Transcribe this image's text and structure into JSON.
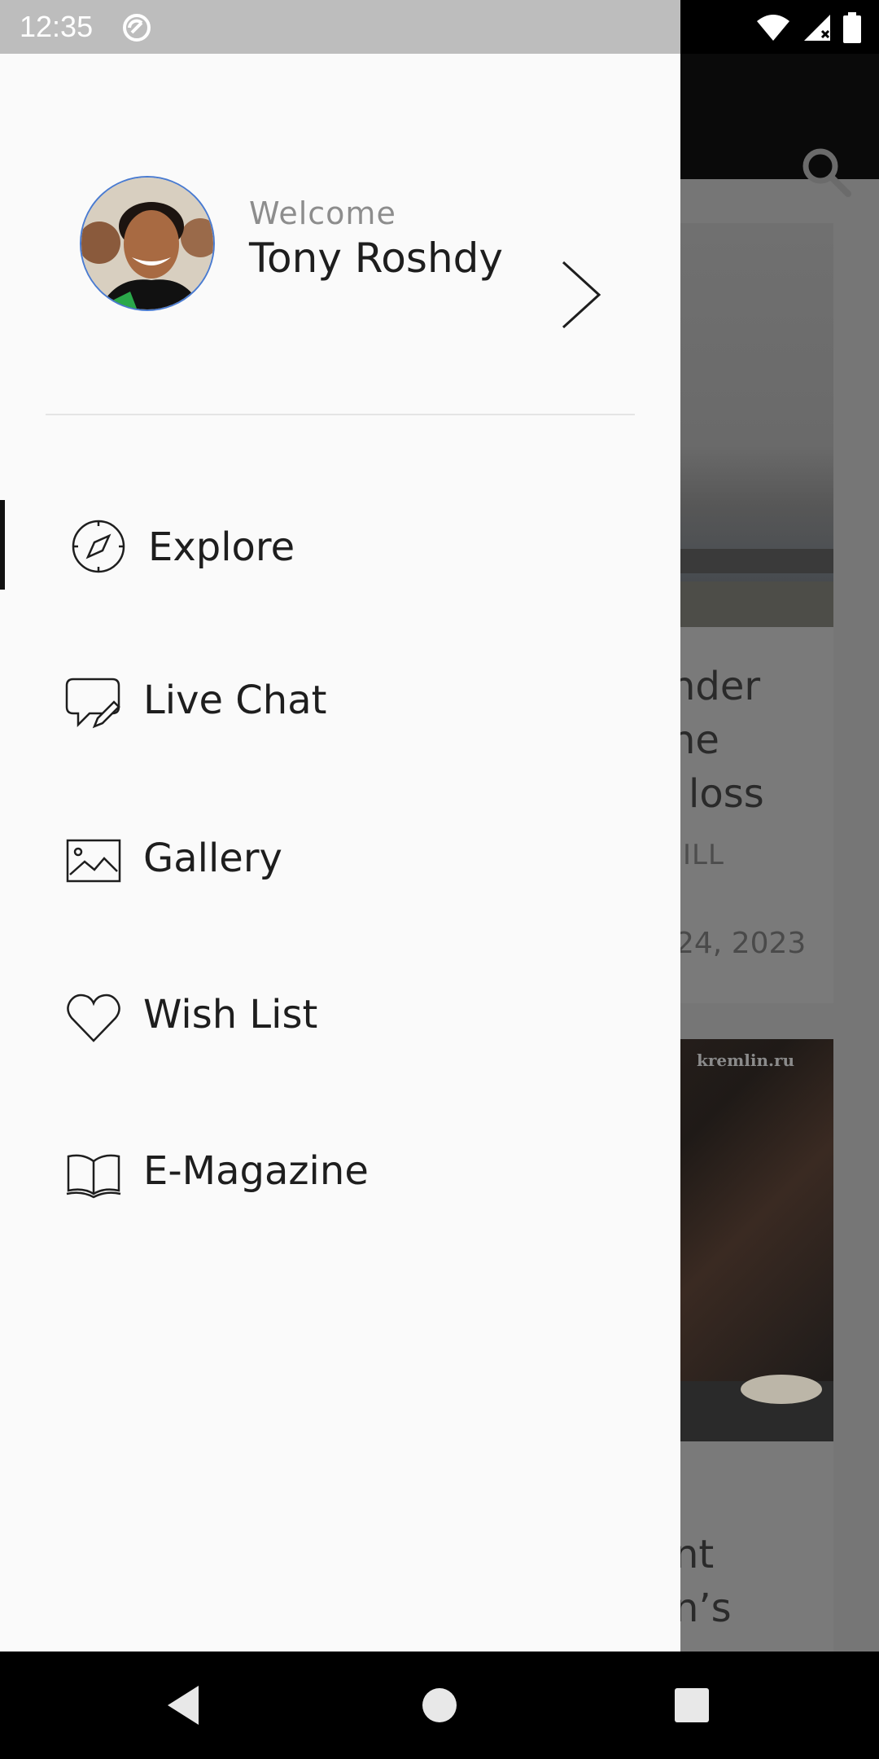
{
  "status_bar": {
    "time": "12:35",
    "icons": [
      "sync-icon",
      "wifi-icon",
      "signal-icon",
      "battery-icon"
    ]
  },
  "background": {
    "headline_fragment_1": "nder",
    "headline_fragment_2": "ne",
    "headline_fragment_3": "loss",
    "author_fragment": "JILL",
    "date_fragment": "24, 2023",
    "watermark": "kremlin.ru",
    "headline2_fragment_1": "nt",
    "headline2_fragment_2": "n’s"
  },
  "drawer": {
    "welcome": "Welcome",
    "user_name": "Tony Roshdy",
    "menu": [
      {
        "label": "Explore",
        "icon": "compass-icon",
        "active": true
      },
      {
        "label": "Live Chat",
        "icon": "chat-edit-icon",
        "active": false
      },
      {
        "label": "Gallery",
        "icon": "image-icon",
        "active": false
      },
      {
        "label": "Wish List",
        "icon": "heart-icon",
        "active": false
      },
      {
        "label": "E-Magazine",
        "icon": "book-icon",
        "active": false
      }
    ]
  },
  "colors": {
    "drawer_bg": "#fafafa",
    "scrim": "#767676",
    "text_primary": "#1e1e1e",
    "text_secondary": "#8d8d8d"
  }
}
